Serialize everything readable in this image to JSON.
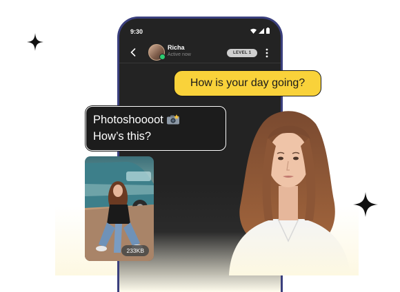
{
  "status_bar": {
    "time": "9:30",
    "icons": [
      "wifi-icon",
      "signal-icon",
      "battery-icon"
    ]
  },
  "chat_header": {
    "contact_name": "Richa",
    "contact_status": "Active now",
    "level_badge": "LEVEL 1",
    "icons": [
      "back-arrow-icon",
      "kebab-menu-icon"
    ]
  },
  "messages": {
    "incoming_question": "How is your day going?",
    "outgoing_line1": "Photoshoooot",
    "outgoing_line2": "How’s this?",
    "photo_size": "233KB"
  },
  "decorations": [
    "sparkle-icon",
    "sparkle-icon"
  ],
  "colors": {
    "bubble_yellow": "#f9d23a",
    "bubble_dark": "#1c1c1c",
    "phone_frame": "#3a3f7d",
    "online": "#2ecc71"
  }
}
